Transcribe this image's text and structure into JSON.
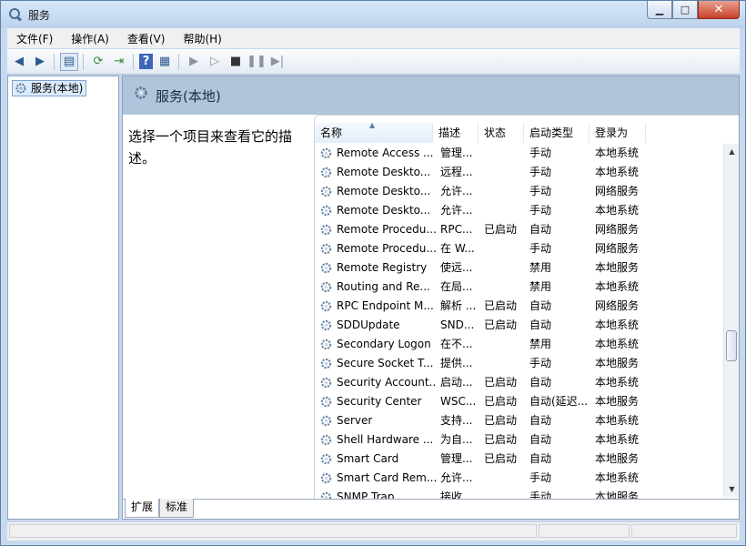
{
  "window": {
    "title": "服务"
  },
  "menubar": {
    "items": [
      "文件(F)",
      "操作(A)",
      "查看(V)",
      "帮助(H)"
    ]
  },
  "toolbar": {
    "icons": [
      "back-arrow-icon",
      "forward-arrow-icon",
      "show-hide-tree-icon",
      "refresh-icon",
      "export-list-icon",
      "help-icon",
      "properties-icon",
      "start-service-icon",
      "start-service-alt-icon",
      "stop-service-icon",
      "pause-service-icon",
      "restart-service-icon"
    ]
  },
  "tree": {
    "selected": "服务(本地)"
  },
  "panel": {
    "title": "服务(本地)",
    "description": "选择一个项目来查看它的描述。"
  },
  "list": {
    "columns": [
      "名称",
      "描述",
      "状态",
      "启动类型",
      "登录为"
    ],
    "rows": [
      [
        "Remote Access ...",
        "管理...",
        "",
        "手动",
        "本地系统"
      ],
      [
        "Remote Deskto...",
        "远程...",
        "",
        "手动",
        "本地系统"
      ],
      [
        "Remote Deskto...",
        "允许...",
        "",
        "手动",
        "网络服务"
      ],
      [
        "Remote Deskto...",
        "允许...",
        "",
        "手动",
        "本地系统"
      ],
      [
        "Remote Procedu...",
        "RPC...",
        "已启动",
        "自动",
        "网络服务"
      ],
      [
        "Remote Procedu...",
        "在 W...",
        "",
        "手动",
        "网络服务"
      ],
      [
        "Remote Registry",
        "使远...",
        "",
        "禁用",
        "本地服务"
      ],
      [
        "Routing and Re...",
        "在局...",
        "",
        "禁用",
        "本地系统"
      ],
      [
        "RPC Endpoint M...",
        "解析 ...",
        "已启动",
        "自动",
        "网络服务"
      ],
      [
        "SDDUpdate",
        "SND...",
        "已启动",
        "自动",
        "本地系统"
      ],
      [
        "Secondary Logon",
        "在不...",
        "",
        "禁用",
        "本地系统"
      ],
      [
        "Secure Socket T...",
        "提供...",
        "",
        "手动",
        "本地服务"
      ],
      [
        "Security Account...",
        "启动...",
        "已启动",
        "自动",
        "本地系统"
      ],
      [
        "Security Center",
        "WSC...",
        "已启动",
        "自动(延迟...",
        "本地服务"
      ],
      [
        "Server",
        "支持...",
        "已启动",
        "自动",
        "本地系统"
      ],
      [
        "Shell Hardware ...",
        "为自...",
        "已启动",
        "自动",
        "本地系统"
      ],
      [
        "Smart Card",
        "管理...",
        "已启动",
        "自动",
        "本地服务"
      ],
      [
        "Smart Card Rem...",
        "允许...",
        "",
        "手动",
        "本地系统"
      ],
      [
        "SNMP Trap",
        "接收...",
        "",
        "手动",
        "本地服务"
      ]
    ]
  },
  "tabs": [
    "扩展",
    "标准"
  ],
  "colors": {
    "header_band": "#b0c5db",
    "frame": "#c7d9ee",
    "selection": "#dcebfc"
  }
}
